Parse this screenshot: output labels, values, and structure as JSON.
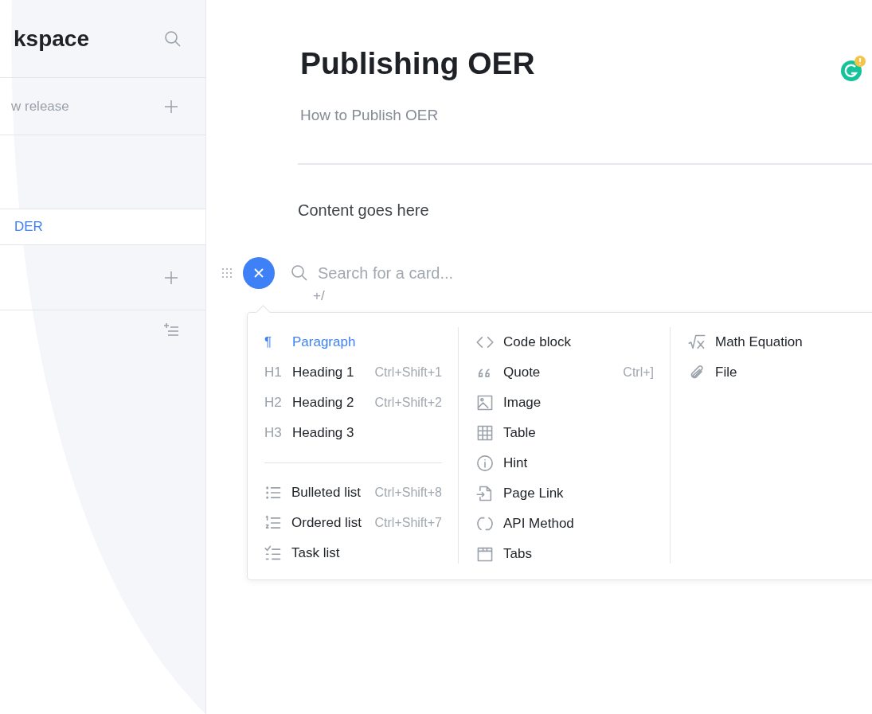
{
  "sidebar": {
    "title": "kspace",
    "items": [
      {
        "kind": "section",
        "label": "w release",
        "selected": false
      },
      {
        "kind": "page",
        "label": "DER",
        "selected": true
      },
      {
        "kind": "section",
        "selected": false
      },
      {
        "kind": "section-list",
        "selected": false
      }
    ]
  },
  "page": {
    "title": "Publishing OER",
    "subtitle": "How to Publish OER",
    "body": "Content goes here"
  },
  "card_picker": {
    "placeholder": "Search for a card...",
    "hint": "+/",
    "columns": [
      {
        "groups": [
          {
            "items": [
              {
                "marker": "¶",
                "label": "Paragraph",
                "selected": true
              },
              {
                "marker": "H1",
                "label": "Heading 1",
                "shortcut": "Ctrl+Shift+1",
                "selected": false
              },
              {
                "marker": "H2",
                "label": "Heading 2",
                "shortcut": "Ctrl+Shift+2",
                "selected": false
              },
              {
                "marker": "H3",
                "label": "Heading 3",
                "selected": false
              }
            ]
          },
          {
            "items": [
              {
                "kind": "bulleted",
                "label": "Bulleted list",
                "shortcut": "Ctrl+Shift+8",
                "selected": false
              },
              {
                "kind": "ordered",
                "label": "Ordered list",
                "shortcut": "Ctrl+Shift+7",
                "selected": false
              },
              {
                "kind": "task",
                "label": "Task list",
                "selected": false
              }
            ]
          }
        ]
      },
      {
        "groups": [
          {
            "items": [
              {
                "kind": "code",
                "label": "Code block",
                "selected": false
              },
              {
                "kind": "quote",
                "label": "Quote",
                "shortcut": "Ctrl+]",
                "selected": false
              },
              {
                "kind": "image",
                "label": "Image",
                "selected": false
              },
              {
                "kind": "table",
                "label": "Table",
                "selected": false
              },
              {
                "kind": "hint",
                "label": "Hint",
                "selected": false
              },
              {
                "kind": "page-link",
                "label": "Page Link",
                "selected": false
              },
              {
                "kind": "api",
                "label": "API Method",
                "selected": false
              },
              {
                "kind": "tabs",
                "label": "Tabs",
                "selected": false
              }
            ]
          }
        ]
      },
      {
        "groups": [
          {
            "items": [
              {
                "kind": "math",
                "label": "Math Equation",
                "selected": false
              },
              {
                "kind": "file",
                "label": "File",
                "selected": false
              }
            ]
          }
        ]
      }
    ]
  }
}
